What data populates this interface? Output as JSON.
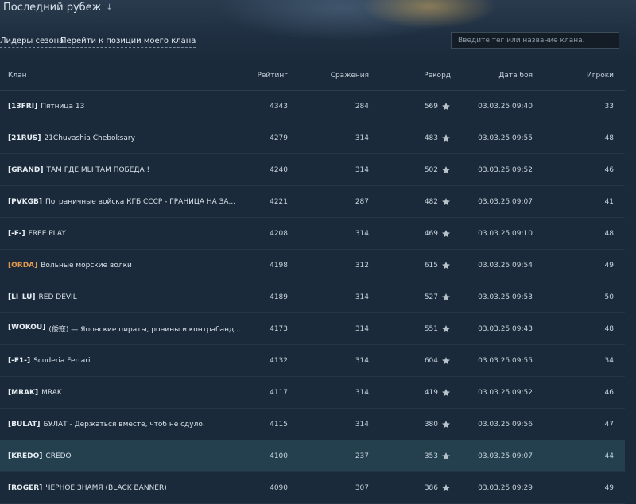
{
  "header": {
    "title": "Последний рубеж",
    "title_icon": "arrow-down-icon"
  },
  "nav": {
    "season_leaders": "Лидеры сезона",
    "goto_my_clan": "Перейти к позиции моего клана"
  },
  "search": {
    "placeholder": "Введите тег или название клана."
  },
  "table": {
    "columns": [
      "Клан",
      "Рейтинг",
      "Сражения",
      "Рекорд",
      "Дата боя",
      "Игроки"
    ],
    "rows": [
      {
        "tag": "[13FRI]",
        "name": "Пятница 13",
        "rating": "4343",
        "battles": "284",
        "record": "569",
        "date": "03.03.25 09:40",
        "players": "33"
      },
      {
        "tag": "[21RUS]",
        "name": "21Chuvashia Cheboksary",
        "rating": "4279",
        "battles": "314",
        "record": "483",
        "date": "03.03.25 09:55",
        "players": "48"
      },
      {
        "tag": "[GRAND]",
        "name": "ТАМ ГДЕ МЫ ТАМ ПОБЕДА !",
        "rating": "4240",
        "battles": "314",
        "record": "502",
        "date": "03.03.25 09:52",
        "players": "46"
      },
      {
        "tag": "[PVKGB]",
        "name": "Пограничные войска КГБ СССР - ГРАНИЦА НА ЗА...",
        "rating": "4221",
        "battles": "287",
        "record": "482",
        "date": "03.03.25 09:07",
        "players": "41"
      },
      {
        "tag": "[-F-]",
        "name": "FREE PLAY",
        "rating": "4208",
        "battles": "314",
        "record": "469",
        "date": "03.03.25 09:10",
        "players": "48"
      },
      {
        "tag": "[ORDA]",
        "name": "Вольные морские волки",
        "rating": "4198",
        "battles": "312",
        "record": "615",
        "date": "03.03.25 09:54",
        "players": "49"
      },
      {
        "tag": "[LI_LU]",
        "name": "RED DEVIL",
        "rating": "4189",
        "battles": "314",
        "record": "527",
        "date": "03.03.25 09:53",
        "players": "50"
      },
      {
        "tag": "[WOKOU]",
        "name": "(倭寇) — Японские пираты, ронины и контрабанд...",
        "rating": "4173",
        "battles": "314",
        "record": "551",
        "date": "03.03.25 09:43",
        "players": "48"
      },
      {
        "tag": "[-F1-]",
        "name": "Scuderia Ferrari",
        "rating": "4132",
        "battles": "314",
        "record": "604",
        "date": "03.03.25 09:55",
        "players": "34"
      },
      {
        "tag": "[MRAK]",
        "name": "MRAK",
        "rating": "4117",
        "battles": "314",
        "record": "419",
        "date": "03.03.25 09:52",
        "players": "46"
      },
      {
        "tag": "[BULAT]",
        "name": "БУЛАТ - Держаться вместе, чтоб не сдуло.",
        "rating": "4115",
        "battles": "314",
        "record": "380",
        "date": "03.03.25 09:56",
        "players": "47"
      },
      {
        "tag": "[KREDO]",
        "name": "CREDO",
        "rating": "4100",
        "battles": "237",
        "record": "353",
        "date": "03.03.25 09:07",
        "players": "44"
      },
      {
        "tag": "[ROGER]",
        "name": "ЧЕРНОЕ ЗНАМЯ (BLACK BANNER)",
        "rating": "4090",
        "battles": "307",
        "record": "386",
        "date": "03.03.25 09:29",
        "players": "49"
      }
    ]
  },
  "colors": {
    "accent_tag": "#e29a4e",
    "highlight_row": "#24404f"
  }
}
